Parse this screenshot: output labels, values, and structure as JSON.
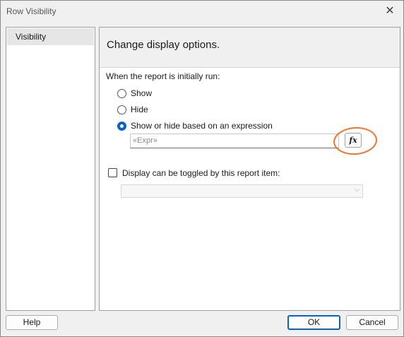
{
  "window": {
    "title": "Row Visibility"
  },
  "sidebar": {
    "items": [
      {
        "label": "Visibility"
      }
    ]
  },
  "content": {
    "header": "Change display options.",
    "initial_label": "When the report is initially run:",
    "radio_options": [
      {
        "label": "Show",
        "checked": false
      },
      {
        "label": "Hide",
        "checked": false
      },
      {
        "label": "Show or hide based on an expression",
        "checked": true
      }
    ],
    "expression": {
      "value": "«Expr»",
      "fx_label": "fx"
    },
    "toggle_checkbox": {
      "label": "Display can be toggled by this report item:",
      "checked": false
    },
    "toggle_dropdown": {
      "value": ""
    }
  },
  "footer": {
    "help_label": "Help",
    "ok_label": "OK",
    "cancel_label": "Cancel"
  },
  "annotation": {
    "color": "#f07530"
  }
}
